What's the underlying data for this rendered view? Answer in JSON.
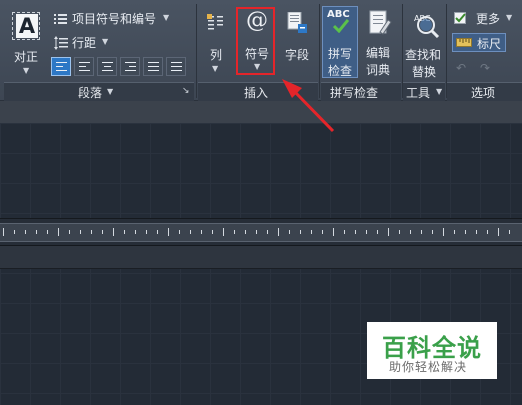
{
  "ribbon": {
    "paragraph": {
      "justify_label": "对正",
      "bullets_label": "项目符号和编号",
      "linespacing_label": "行距",
      "group_label": "段落"
    },
    "insert": {
      "columns_label": "列",
      "symbol_label": "符号",
      "field_label": "字段",
      "group_label": "插入"
    },
    "spellcheck": {
      "abc_text": "ABC",
      "check_label_1": "拼写",
      "check_label_2": "检查",
      "dict_label_1": "编辑",
      "dict_label_2": "词典",
      "group_label": "拼写检查"
    },
    "tools": {
      "find_label_1": "查找和",
      "find_label_2": "替换",
      "group_label": "工具"
    },
    "options": {
      "more_label": "更多",
      "ruler_label": "标尺",
      "group_label": "选项"
    }
  },
  "watermark": {
    "title": "百科全说",
    "subtitle": "助你轻松解决"
  },
  "colors": {
    "highlight_box": "#e5252a",
    "arrow": "#e5252a",
    "selected_blue": "#2d78c6",
    "watermark_green": "#3aa04a"
  }
}
